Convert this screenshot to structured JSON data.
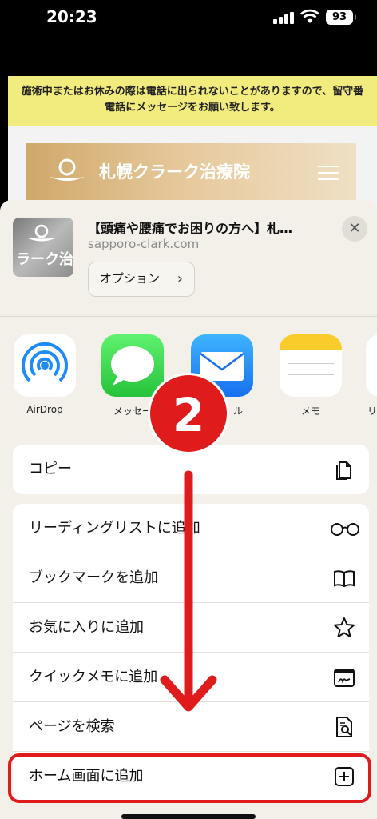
{
  "status": {
    "time": "20:23",
    "battery": "93"
  },
  "website": {
    "notice": "施術中またはお休みの際は電話に出られないことがありますので、留守番電話にメッセージをお願い致します。",
    "site_title": "札幌クラーク治療院"
  },
  "share": {
    "thumbnail_text": "ラーク治",
    "page_title": "【頭痛や腰痛でお困りの方へ】札…",
    "url": "sapporo-clark.com",
    "options_label": "オプション",
    "close_icon": "close-icon",
    "apps": [
      {
        "label": "AirDrop",
        "icon": "airdrop-icon"
      },
      {
        "label": "メッセー",
        "icon": "messages-icon"
      },
      {
        "label": "ル",
        "icon": "mail-icon"
      },
      {
        "label": "メモ",
        "icon": "notes-icon"
      },
      {
        "label": "リ",
        "icon": "reminders-icon"
      }
    ],
    "actions_group1": [
      {
        "label": "コピー",
        "icon": "copy-icon"
      }
    ],
    "actions_group2": [
      {
        "label": "リーディングリストに追加",
        "icon": "glasses-icon"
      },
      {
        "label": "ブックマークを追加",
        "icon": "book-icon"
      },
      {
        "label": "お気に入りに追加",
        "icon": "star-icon"
      },
      {
        "label": "クイックメモに追加",
        "icon": "quick-note-icon"
      },
      {
        "label": "ページを検索",
        "icon": "find-in-page-icon"
      },
      {
        "label": "ホーム画面に追加",
        "icon": "plus-square-icon"
      }
    ]
  },
  "overlay": {
    "step_number": "2",
    "accent_color": "#e01b1b"
  }
}
